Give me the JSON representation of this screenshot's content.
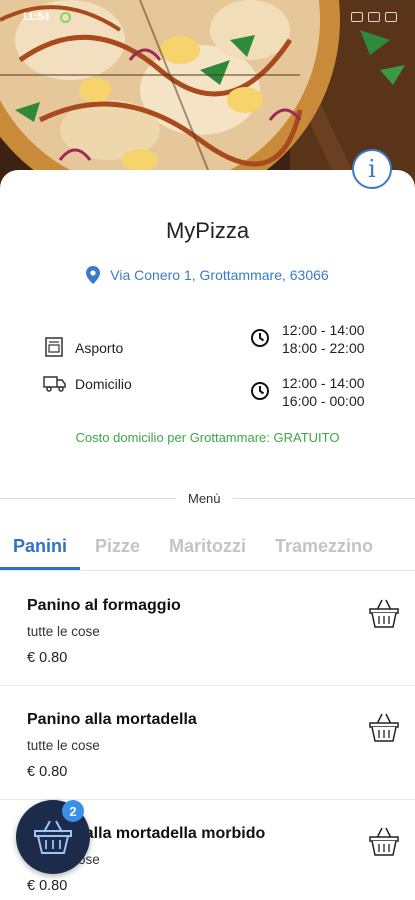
{
  "status_bar": {
    "time": "11:54"
  },
  "restaurant": {
    "name": "MyPizza",
    "address": "Via Conero 1, Grottammare, 63066"
  },
  "services": [
    {
      "label": "Asporto",
      "icon": "takeaway-bag-icon",
      "hours_line1": "12:00 - 14:00",
      "hours_line2": "18:00 - 22:00"
    },
    {
      "label": "Domicilio",
      "icon": "delivery-truck-icon",
      "hours_line1": "12:00 - 14:00",
      "hours_line2": "16:00 - 00:00"
    }
  ],
  "delivery_cost": "Costo domicilio per Grottammare: GRATUITO",
  "menu_divider": "Menù",
  "tabs": [
    {
      "label": "Panini",
      "active": true
    },
    {
      "label": "Pizze",
      "active": false
    },
    {
      "label": "Maritozzi",
      "active": false
    },
    {
      "label": "Tramezzino",
      "active": false
    }
  ],
  "items": [
    {
      "name": "Panino al formaggio",
      "description": "tutte le cose",
      "price": "€ 0.80"
    },
    {
      "name": "Panino alla mortadella",
      "description": "tutte le cose",
      "price": "€ 0.80"
    },
    {
      "name": "Panino alla mortadella morbido",
      "description": "tutte le cose",
      "price": "€ 0.80"
    }
  ],
  "cart": {
    "count": "2"
  },
  "colors": {
    "accent": "#2e73c4",
    "info": "#3c78c8",
    "success": "#3aa845",
    "fab": "#1b2b49",
    "badge": "#3b8fe8"
  }
}
